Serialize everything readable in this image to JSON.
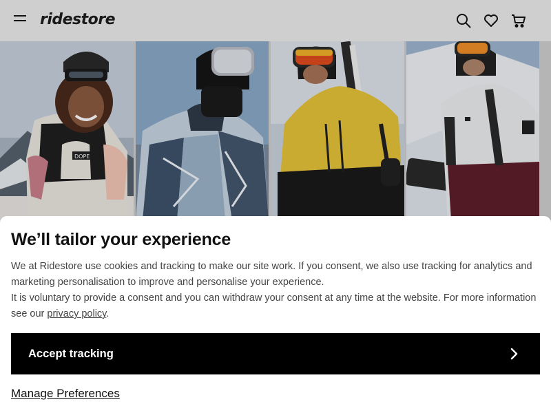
{
  "header": {
    "logo_text": "ridestore",
    "icons": [
      "menu-icon",
      "search-icon",
      "heart-icon",
      "cart-icon"
    ]
  },
  "hero": {
    "tiles": [
      {
        "name": "hero-tile-1"
      },
      {
        "name": "hero-tile-2"
      },
      {
        "name": "hero-tile-3"
      },
      {
        "name": "hero-tile-4"
      }
    ],
    "tile_1_print": "DOPE"
  },
  "cookie": {
    "title": "We’ll tailor your experience",
    "paragraph_1": "We at Ridestore use cookies and tracking to make our site work. If you consent, we also use tracking for analytics and marketing personalisation to improve and personalise your experience.",
    "paragraph_2_before": "It is voluntary to provide a consent and you can withdraw your consent at any time at the website. For more information see our ",
    "privacy_link": "privacy policy",
    "paragraph_2_after": ".",
    "accept_label": "Accept tracking",
    "manage_label": "Manage Preferences"
  },
  "colors": {
    "header_bg": "#cfcfcf",
    "sheet_bg": "#ffffff",
    "accept_bg": "#000000",
    "text_muted": "#444444"
  }
}
